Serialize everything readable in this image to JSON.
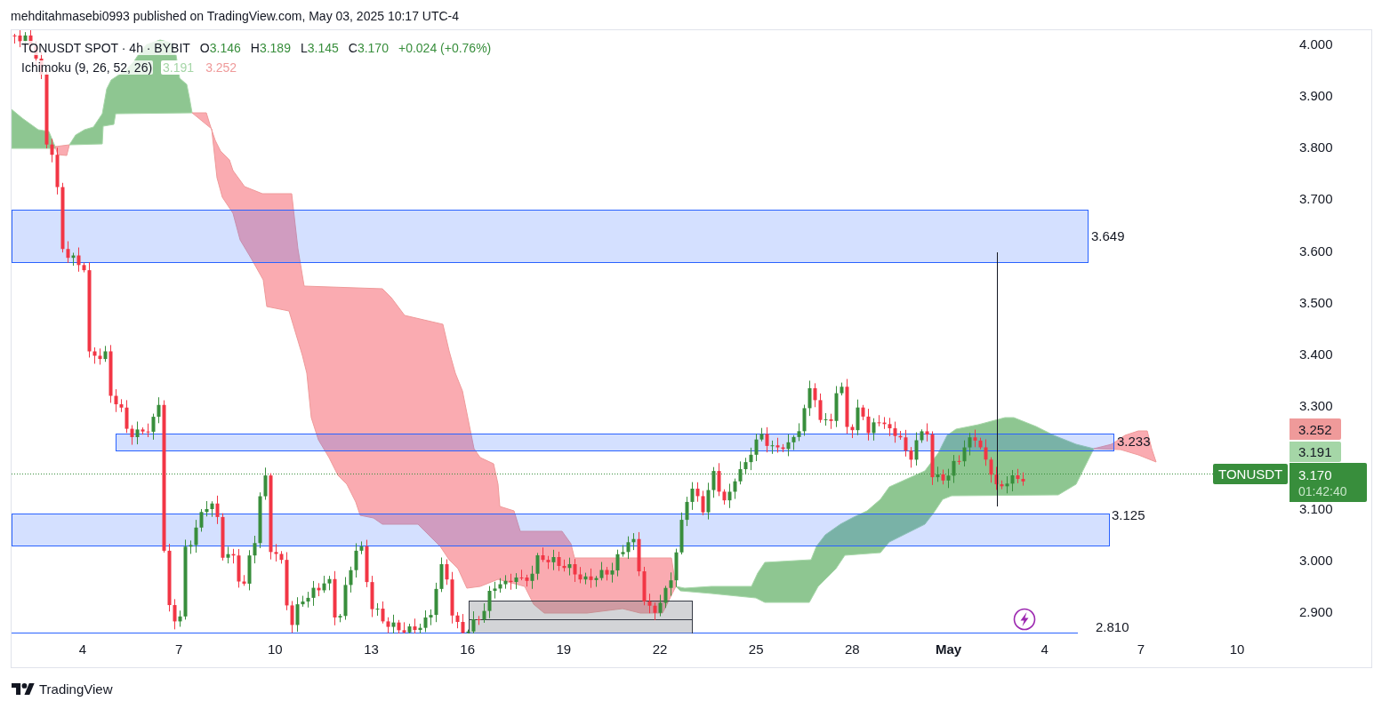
{
  "header": {
    "caption": "mehditahmasebi0993 published on TradingView.com, May 03, 2025 10:17 UTC-4"
  },
  "legend": {
    "symbol": "TONUSDT SPOT · 4h · BYBIT",
    "ohlc": [
      {
        "key": "O",
        "value": "3.146"
      },
      {
        "key": "H",
        "value": "3.189"
      },
      {
        "key": "L",
        "value": "3.145"
      },
      {
        "key": "C",
        "value": "3.170"
      }
    ],
    "change": "+0.024 (+0.76%)",
    "indicator": {
      "name": "Ichimoku (9, 26, 52, 26)",
      "values": [
        {
          "value": "3.191",
          "color": "#a5d6a7"
        },
        {
          "value": "3.252",
          "color": "#ef9a9a"
        }
      ]
    }
  },
  "chart": {
    "zones": [
      {
        "label": "3.649"
      },
      {
        "label": "3.233"
      },
      {
        "label": "3.125"
      },
      {
        "label": "2.810"
      }
    ]
  },
  "price_axis": {
    "labels": [
      "4.000",
      "3.900",
      "3.800",
      "3.700",
      "3.600",
      "3.500",
      "3.400",
      "3.300",
      "3.100",
      "3.000",
      "2.900"
    ],
    "badges": [
      {
        "kind": "indicator",
        "value": "3.252",
        "color": "#ef9a9a"
      },
      {
        "kind": "indicator",
        "value": "3.191",
        "color": "#a5d6a7"
      },
      {
        "kind": "last",
        "symbol": "TONUSDT",
        "value": "3.170",
        "countdown": "01:42:40",
        "color": "#388e3c"
      }
    ]
  },
  "time_axis": {
    "labels": [
      {
        "text": "4",
        "kind": "day"
      },
      {
        "text": "7",
        "kind": "day"
      },
      {
        "text": "10",
        "kind": "day"
      },
      {
        "text": "13",
        "kind": "day"
      },
      {
        "text": "16",
        "kind": "day"
      },
      {
        "text": "19",
        "kind": "day"
      },
      {
        "text": "22",
        "kind": "day"
      },
      {
        "text": "25",
        "kind": "day"
      },
      {
        "text": "28",
        "kind": "day"
      },
      {
        "text": "May",
        "kind": "month"
      },
      {
        "text": "4",
        "kind": "day"
      },
      {
        "text": "7",
        "kind": "day"
      },
      {
        "text": "10",
        "kind": "day"
      }
    ]
  },
  "footer": {
    "brand": "TradingView"
  }
}
